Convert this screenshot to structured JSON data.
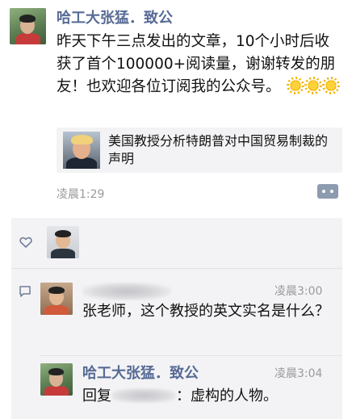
{
  "post": {
    "author": "哈工大张猛．致公",
    "text": "昨天下午三点发出的文章，10个小时后收获了首个100000+阅读量，谢谢转发的朋友！也欢迎各位订阅我的公众号。",
    "emoji": [
      "sun-icon",
      "sun-icon",
      "sun-icon"
    ],
    "link": {
      "title": "美国教授分析特朗普对中国贸易制裁的声明"
    },
    "time": "凌晨1:29"
  },
  "comments": [
    {
      "author": "",
      "time": "凌晨3:00",
      "text": "张老师，这个教授的英文实名是什么？"
    },
    {
      "author": "哈工大张猛．致公",
      "time": "凌晨3:04",
      "reply_prefix": "回复",
      "text": "：虚构的人物。"
    }
  ],
  "colors": {
    "name_blue": "#576b95",
    "comment_bg": "#f3f3f5",
    "timestamp_gray": "#9a9a9a",
    "more_button": "#8d9bb0"
  }
}
